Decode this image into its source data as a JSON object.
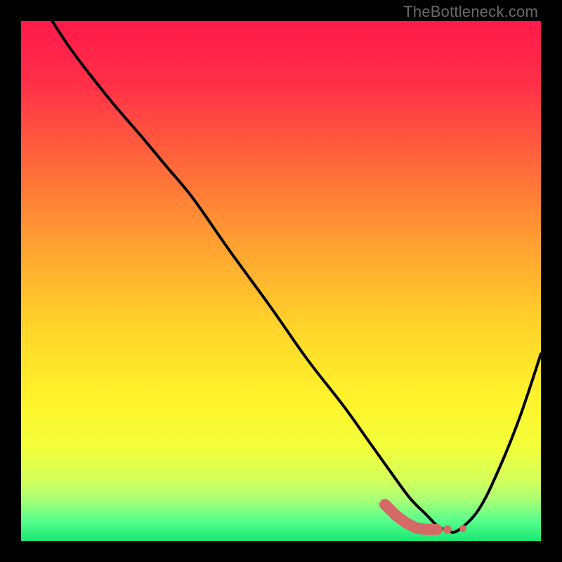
{
  "watermark": "TheBottleneck.com",
  "gradient_stops": [
    {
      "offset": 0,
      "color": "#ff1a4b"
    },
    {
      "offset": 12,
      "color": "#ff2f48"
    },
    {
      "offset": 28,
      "color": "#ff6a3a"
    },
    {
      "offset": 44,
      "color": "#ffa431"
    },
    {
      "offset": 58,
      "color": "#ffd22a"
    },
    {
      "offset": 72,
      "color": "#fff22b"
    },
    {
      "offset": 82,
      "color": "#f2ff3a"
    },
    {
      "offset": 88,
      "color": "#d6ff5a"
    },
    {
      "offset": 92,
      "color": "#aaff74"
    },
    {
      "offset": 96,
      "color": "#59ff8d"
    },
    {
      "offset": 100,
      "color": "#19e873"
    }
  ],
  "curve_color": "#000000",
  "curve_stroke_width": 4,
  "marker_color": "#d46a68",
  "chart_data": {
    "type": "line",
    "title": "",
    "xlabel": "",
    "ylabel": "",
    "xlim": [
      0,
      100
    ],
    "ylim": [
      0,
      100
    ],
    "series": [
      {
        "name": "bottleneck-curve",
        "x": [
          6,
          10,
          17,
          23,
          28,
          33,
          40,
          48,
          55,
          62,
          67,
          72,
          75,
          78,
          80,
          82,
          84,
          88,
          92,
          96,
          100
        ],
        "y": [
          100,
          94,
          85,
          78,
          72,
          66,
          56,
          45,
          35,
          26,
          19,
          12,
          8,
          5,
          3,
          2,
          2,
          6,
          14,
          24,
          36
        ]
      }
    ],
    "markers": {
      "name": "highlighted-region",
      "points": [
        {
          "x": 70,
          "y": 7
        },
        {
          "x": 72,
          "y": 5
        },
        {
          "x": 74,
          "y": 3.5
        },
        {
          "x": 76,
          "y": 2.5
        },
        {
          "x": 78,
          "y": 2.2
        },
        {
          "x": 80,
          "y": 2.2
        },
        {
          "x": 82,
          "y": 2.2
        },
        {
          "x": 85,
          "y": 2.4
        }
      ]
    },
    "note": "x and y are in percent of plot area; y=0 is bottom, y=100 is top. Values estimated from pixels."
  }
}
